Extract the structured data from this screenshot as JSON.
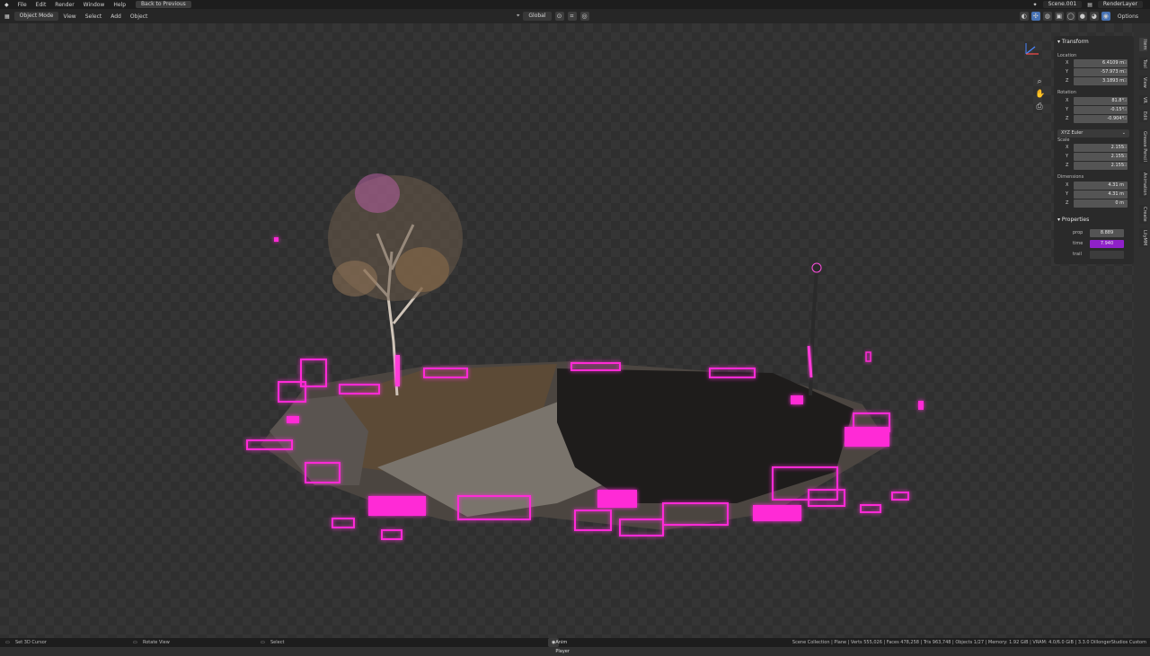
{
  "topbar": {
    "menus": [
      "File",
      "Edit",
      "Render",
      "Window",
      "Help"
    ],
    "back_button": "Back to Previous",
    "scene": "Scene.001",
    "view_layer": "RenderLayer"
  },
  "header": {
    "mode": "Object Mode",
    "menus": [
      "View",
      "Select",
      "Add",
      "Object"
    ],
    "orientation": "Global",
    "options": "Options"
  },
  "npanel": {
    "transform_title": "Transform",
    "location_label": "Location",
    "location": {
      "x": "6.4109 m",
      "y": "-57.973 m",
      "z": "3.1893 m"
    },
    "rotation_label": "Rotation",
    "rotation": {
      "x": "81.8°",
      "y": "-0.15°",
      "z": "-0.904°"
    },
    "rotation_mode": "XYZ Euler",
    "scale_label": "Scale",
    "scale": {
      "x": "2.155",
      "y": "2.155",
      "z": "2.155"
    },
    "dimensions_label": "Dimensions",
    "dimensions": {
      "x": "4.31 m",
      "y": "4.31 m",
      "z": "0 m"
    },
    "properties_title": "Properties",
    "props": [
      {
        "label": "prop",
        "value": "8.889"
      },
      {
        "label": "time",
        "value": "7.940"
      },
      {
        "label": "trail",
        "value": ""
      }
    ],
    "axes": [
      "X",
      "Y",
      "Z"
    ]
  },
  "sidetabs": [
    "Item",
    "Tool",
    "View",
    "VR",
    "Edit",
    "Grease Pencil",
    "Animation",
    "Create",
    "LilyMM"
  ],
  "status": {
    "left": "Set 3D Cursor",
    "middle": "Rotate View",
    "select": "Select",
    "anim": "Anim Player",
    "stats": "Scene Collection | Plane | Verts 555,026 | Faces 478,258 | Tris 963,748 | Objects 1/27 | Memory: 1.92 GiB | VRAM: 4.0/6.0 GiB | 3.3.0 DillongerStudios Custom"
  },
  "colors": {
    "accent_blue": "#4772b3",
    "glow_magenta": "#ff2bd6",
    "prop_purple": "#8f21c9"
  }
}
